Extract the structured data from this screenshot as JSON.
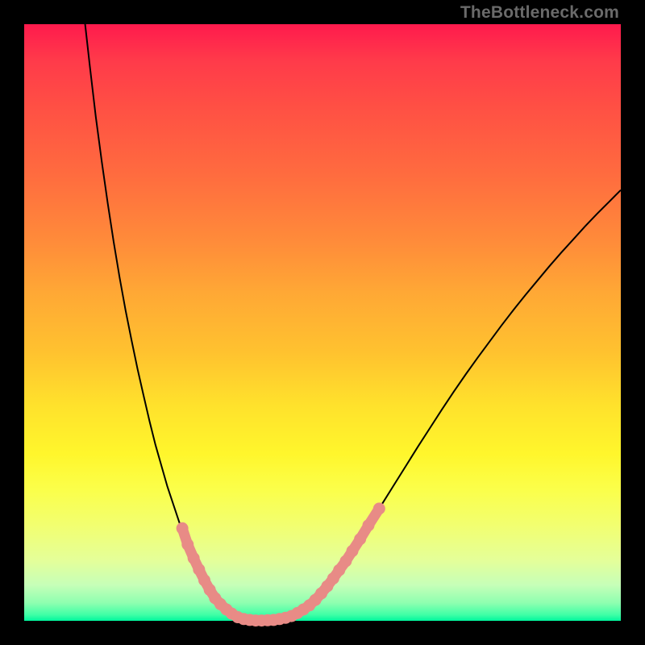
{
  "watermark": "TheBottleneck.com",
  "colors": {
    "curve_stroke": "#000000",
    "marker_fill": "#e88b86",
    "marker_stroke": "#e88b86",
    "frame": "#000000"
  },
  "chart_data": {
    "type": "line",
    "title": "",
    "xlabel": "",
    "ylabel": "",
    "xlim": [
      0,
      100
    ],
    "ylim": [
      0,
      100
    ],
    "grid": false,
    "curves": [
      {
        "name": "left-branch",
        "points": [
          {
            "x": 10.1,
            "y": 101.0
          },
          {
            "x": 11.0,
            "y": 93.0
          },
          {
            "x": 12.0,
            "y": 84.5
          },
          {
            "x": 13.0,
            "y": 77.0
          },
          {
            "x": 14.0,
            "y": 70.0
          },
          {
            "x": 15.0,
            "y": 63.5
          },
          {
            "x": 16.0,
            "y": 57.5
          },
          {
            "x": 17.0,
            "y": 52.0
          },
          {
            "x": 18.0,
            "y": 47.0
          },
          {
            "x": 19.0,
            "y": 42.2
          },
          {
            "x": 20.0,
            "y": 37.8
          },
          {
            "x": 21.0,
            "y": 33.5
          },
          {
            "x": 22.0,
            "y": 29.5
          },
          {
            "x": 23.0,
            "y": 26.0
          },
          {
            "x": 24.0,
            "y": 22.5
          },
          {
            "x": 25.0,
            "y": 19.5
          },
          {
            "x": 26.0,
            "y": 16.5
          },
          {
            "x": 27.0,
            "y": 14.0
          },
          {
            "x": 28.0,
            "y": 11.5
          },
          {
            "x": 29.0,
            "y": 9.2
          },
          {
            "x": 30.0,
            "y": 7.2
          },
          {
            "x": 31.0,
            "y": 5.5
          },
          {
            "x": 32.0,
            "y": 4.0
          },
          {
            "x": 33.0,
            "y": 2.8
          },
          {
            "x": 34.0,
            "y": 1.8
          },
          {
            "x": 35.0,
            "y": 1.0
          },
          {
            "x": 36.0,
            "y": 0.5
          },
          {
            "x": 37.0,
            "y": 0.2
          },
          {
            "x": 38.0,
            "y": 0.1
          },
          {
            "x": 39.0,
            "y": 0.0
          }
        ]
      },
      {
        "name": "right-branch",
        "points": [
          {
            "x": 39.0,
            "y": 0.0
          },
          {
            "x": 40.0,
            "y": 0.05
          },
          {
            "x": 41.0,
            "y": 0.1
          },
          {
            "x": 42.0,
            "y": 0.2
          },
          {
            "x": 43.0,
            "y": 0.35
          },
          {
            "x": 44.0,
            "y": 0.55
          },
          {
            "x": 45.0,
            "y": 0.9
          },
          {
            "x": 46.0,
            "y": 1.4
          },
          {
            "x": 47.0,
            "y": 2.0
          },
          {
            "x": 48.0,
            "y": 2.8
          },
          {
            "x": 50.0,
            "y": 4.8
          },
          {
            "x": 52.0,
            "y": 7.4
          },
          {
            "x": 54.0,
            "y": 10.2
          },
          {
            "x": 56.0,
            "y": 13.2
          },
          {
            "x": 58.0,
            "y": 16.4
          },
          {
            "x": 60.0,
            "y": 19.6
          },
          {
            "x": 62.0,
            "y": 22.8
          },
          {
            "x": 64.0,
            "y": 26.0
          },
          {
            "x": 66.0,
            "y": 29.2
          },
          {
            "x": 68.0,
            "y": 32.3
          },
          {
            "x": 70.0,
            "y": 35.4
          },
          {
            "x": 72.0,
            "y": 38.4
          },
          {
            "x": 74.0,
            "y": 41.3
          },
          {
            "x": 76.0,
            "y": 44.1
          },
          {
            "x": 78.0,
            "y": 46.8
          },
          {
            "x": 80.0,
            "y": 49.5
          },
          {
            "x": 82.0,
            "y": 52.1
          },
          {
            "x": 84.0,
            "y": 54.6
          },
          {
            "x": 86.0,
            "y": 57.0
          },
          {
            "x": 88.0,
            "y": 59.4
          },
          {
            "x": 90.0,
            "y": 61.7
          },
          {
            "x": 92.0,
            "y": 63.9
          },
          {
            "x": 94.0,
            "y": 66.1
          },
          {
            "x": 96.0,
            "y": 68.2
          },
          {
            "x": 98.0,
            "y": 70.2
          },
          {
            "x": 100.0,
            "y": 72.2
          }
        ]
      }
    ],
    "series": [
      {
        "name": "markers",
        "style": "scatter-segments",
        "points": [
          {
            "x": 26.5,
            "y": 15.5
          },
          {
            "x": 27.4,
            "y": 12.8
          },
          {
            "x": 28.4,
            "y": 10.5
          },
          {
            "x": 29.3,
            "y": 8.6
          },
          {
            "x": 30.2,
            "y": 6.8
          },
          {
            "x": 31.1,
            "y": 5.2
          },
          {
            "x": 32.0,
            "y": 3.8
          },
          {
            "x": 32.9,
            "y": 2.8
          },
          {
            "x": 33.9,
            "y": 1.9
          },
          {
            "x": 34.8,
            "y": 1.2
          },
          {
            "x": 35.8,
            "y": 0.6
          },
          {
            "x": 36.8,
            "y": 0.3
          },
          {
            "x": 37.8,
            "y": 0.15
          },
          {
            "x": 38.8,
            "y": 0.05
          },
          {
            "x": 39.8,
            "y": 0.05
          },
          {
            "x": 40.8,
            "y": 0.1
          },
          {
            "x": 41.8,
            "y": 0.15
          },
          {
            "x": 42.8,
            "y": 0.3
          },
          {
            "x": 43.8,
            "y": 0.5
          },
          {
            "x": 44.8,
            "y": 0.8
          },
          {
            "x": 45.8,
            "y": 1.3
          },
          {
            "x": 46.8,
            "y": 1.9
          },
          {
            "x": 47.8,
            "y": 2.6
          },
          {
            "x": 48.8,
            "y": 3.5
          },
          {
            "x": 49.8,
            "y": 4.6
          },
          {
            "x": 50.8,
            "y": 5.8
          },
          {
            "x": 51.8,
            "y": 7.1
          },
          {
            "x": 52.8,
            "y": 8.5
          },
          {
            "x": 53.9,
            "y": 10.0
          },
          {
            "x": 55.0,
            "y": 11.7
          },
          {
            "x": 56.3,
            "y": 13.7
          },
          {
            "x": 57.7,
            "y": 16.0
          },
          {
            "x": 59.5,
            "y": 18.8
          }
        ]
      }
    ]
  }
}
